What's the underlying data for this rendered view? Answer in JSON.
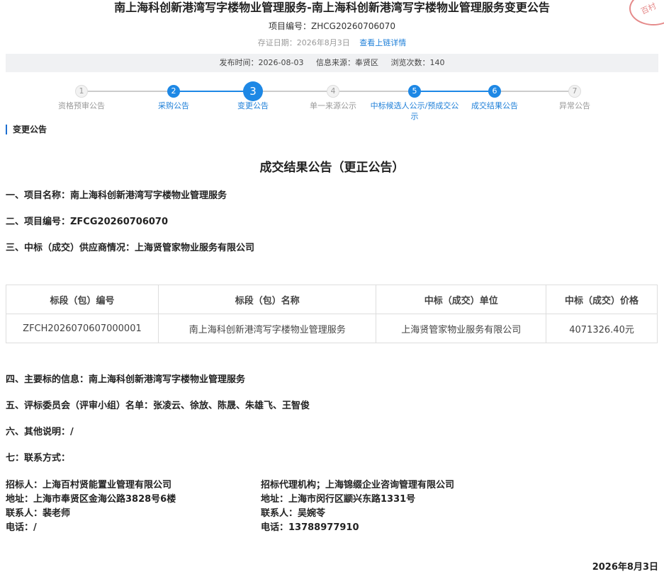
{
  "header": {
    "title": "南上海科创新港湾写字楼物业管理服务-南上海科创新港湾写字楼物业管理服务变更公告",
    "project_no_label": "项目编号：",
    "project_no": "ZHCG20260706070",
    "cert_date_label": "存证日期：2026年8月3日",
    "chain_link": "查看上链详情"
  },
  "infobar": {
    "publish_time": "发布时间：2026-08-03",
    "source": "信息来源：奉贤区",
    "views": "浏览次数：140"
  },
  "steps": [
    {
      "num": "1",
      "label": "资格预审公告",
      "state": "inactive"
    },
    {
      "num": "2",
      "label": "采购公告",
      "state": "done"
    },
    {
      "num": "3",
      "label": "变更公告",
      "state": "current"
    },
    {
      "num": "4",
      "label": "单一来源公示",
      "state": "inactive"
    },
    {
      "num": "5",
      "label": "中标候选人公示/预成交公示",
      "state": "done"
    },
    {
      "num": "6",
      "label": "成交结果公告",
      "state": "done"
    },
    {
      "num": "7",
      "label": "异常公告",
      "state": "inactive"
    }
  ],
  "section_title": "变更公告",
  "notice": {
    "title": "成交结果公告（更正公告）",
    "item1": "一、项目名称：南上海科创新港湾写字楼物业管理服务",
    "item2": "二、项目编号：ZFCG20260706070",
    "item3": "三、中标（成交）供应商情况：上海贤管家物业服务有限公司",
    "table": {
      "headers": [
        "标段（包）编号",
        "标段（包）名称",
        "中标（成交）单位",
        "中标（成交）价格"
      ],
      "rows": [
        [
          "ZFCH2026070607000001",
          "南上海科创新港湾写字楼物业管理服务",
          "上海贤管家物业服务有限公司",
          "4071326.40元"
        ]
      ]
    },
    "item4": "四、主要标的信息：南上海科创新港湾写字楼物业管理服务",
    "item5": "五、评标委员会（评审小组）名单：张凌云、徐放、陈晟、朱雄飞、王智俊",
    "item6": "六、其他说明：/",
    "item7": "七：联系方式：",
    "contact_left": {
      "org": "招标人：上海百村贤能置业管理有限公司",
      "addr": "地址：上海市奉贤区金海公路3828号6楼",
      "person": "联系人：裴老师",
      "phone": "电话：/"
    },
    "contact_right": {
      "org": "招标代理机构；上海锦缀企业咨询管理有限公司",
      "addr": "地址：上海市闵行区颛兴东路1331号",
      "person": "联系人：吴婉苓",
      "phone": "电话：13788977910"
    },
    "date": "2026年8月3日"
  },
  "colors": {
    "accent": "#1e88e5",
    "inactive": "#cccccc",
    "seal": "#e58a8a"
  },
  "seal_text": "百村"
}
